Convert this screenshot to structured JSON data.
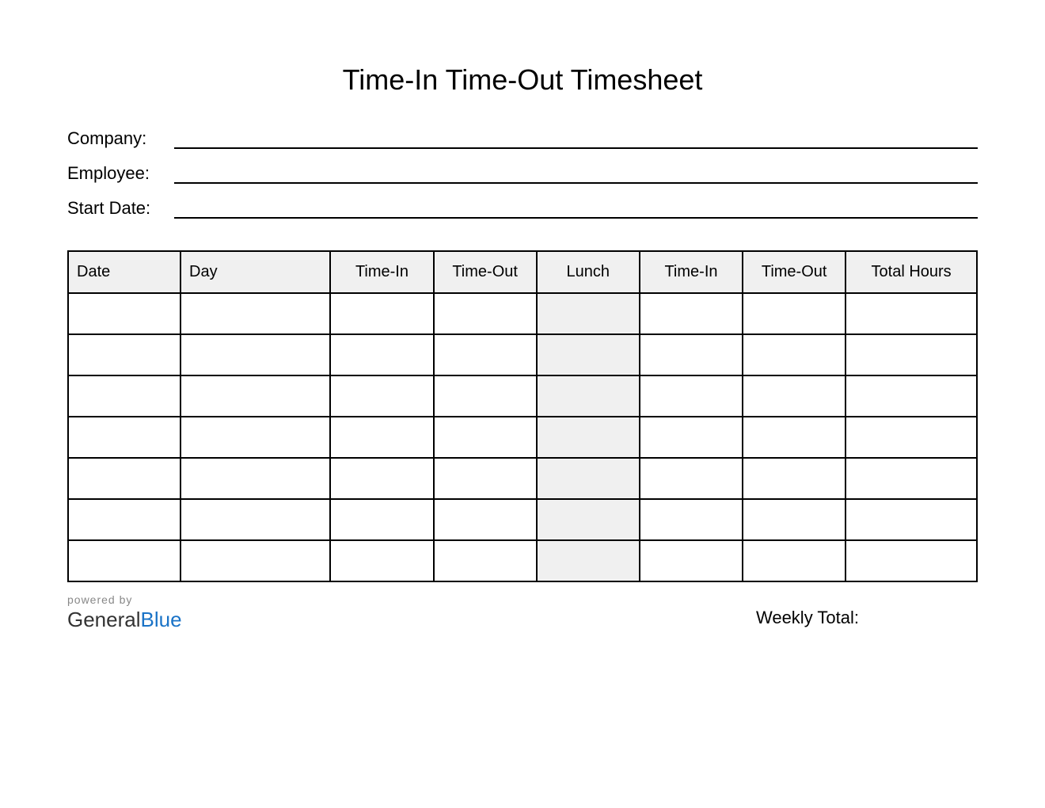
{
  "title": "Time-In Time-Out Timesheet",
  "info": {
    "company_label": "Company:",
    "company_value": "",
    "employee_label": "Employee:",
    "employee_value": "",
    "start_date_label": "Start Date:",
    "start_date_value": ""
  },
  "table": {
    "headers": {
      "date": "Date",
      "day": "Day",
      "time_in_1": "Time-In",
      "time_out_1": "Time-Out",
      "lunch": "Lunch",
      "time_in_2": "Time-In",
      "time_out_2": "Time-Out",
      "total_hours": "Total Hours"
    },
    "rows": [
      {
        "date": "",
        "day": "",
        "time_in_1": "",
        "time_out_1": "",
        "lunch": "",
        "time_in_2": "",
        "time_out_2": "",
        "total_hours": ""
      },
      {
        "date": "",
        "day": "",
        "time_in_1": "",
        "time_out_1": "",
        "lunch": "",
        "time_in_2": "",
        "time_out_2": "",
        "total_hours": ""
      },
      {
        "date": "",
        "day": "",
        "time_in_1": "",
        "time_out_1": "",
        "lunch": "",
        "time_in_2": "",
        "time_out_2": "",
        "total_hours": ""
      },
      {
        "date": "",
        "day": "",
        "time_in_1": "",
        "time_out_1": "",
        "lunch": "",
        "time_in_2": "",
        "time_out_2": "",
        "total_hours": ""
      },
      {
        "date": "",
        "day": "",
        "time_in_1": "",
        "time_out_1": "",
        "lunch": "",
        "time_in_2": "",
        "time_out_2": "",
        "total_hours": ""
      },
      {
        "date": "",
        "day": "",
        "time_in_1": "",
        "time_out_1": "",
        "lunch": "",
        "time_in_2": "",
        "time_out_2": "",
        "total_hours": ""
      },
      {
        "date": "",
        "day": "",
        "time_in_1": "",
        "time_out_1": "",
        "lunch": "",
        "time_in_2": "",
        "time_out_2": "",
        "total_hours": ""
      }
    ]
  },
  "footer": {
    "powered_by": "powered by",
    "brand_general": "General",
    "brand_blue": "Blue",
    "weekly_total_label": "Weekly Total:",
    "weekly_total_value": ""
  }
}
